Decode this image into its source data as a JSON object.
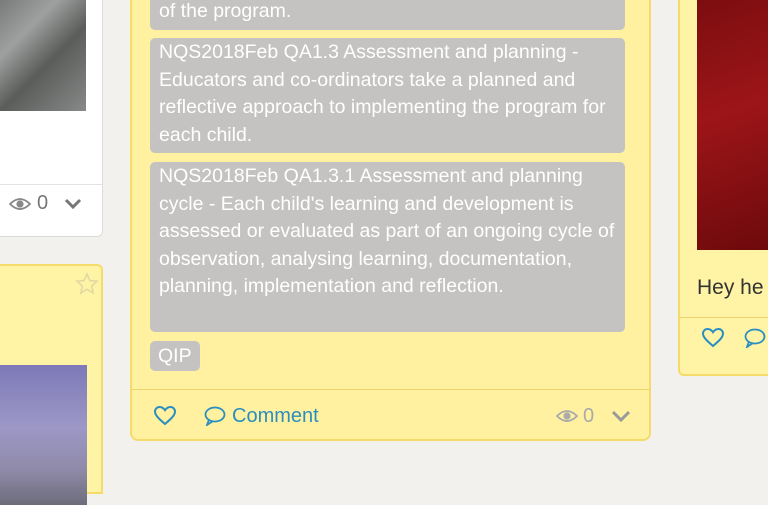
{
  "cards": {
    "left_top": {
      "view_count": "0"
    },
    "center": {
      "tags": [
        "of the program.",
        "NQS2018Feb QA1.3 Assessment and planning - Educators and co-ordinators take a planned and reflective approach to implementing the program for each child.",
        "NQS2018Feb QA1.3.1 Assessment and planning cycle - Each child's learning and development is assessed or evaluated as part of an ongoing cycle of observation, analysing learning, documentation, planning, implementation and reflection.",
        "QIP"
      ],
      "comment_label": "Comment",
      "view_count": "0"
    },
    "right": {
      "text": "Hey he"
    }
  },
  "icons": [
    "eye-icon",
    "chevron-down-icon",
    "star-icon",
    "heart-icon",
    "comment-icon"
  ],
  "colors": {
    "card_yellow": "#fff1a0",
    "tag_gray": "#c4c3c1",
    "link_blue": "#2a8fc0"
  }
}
